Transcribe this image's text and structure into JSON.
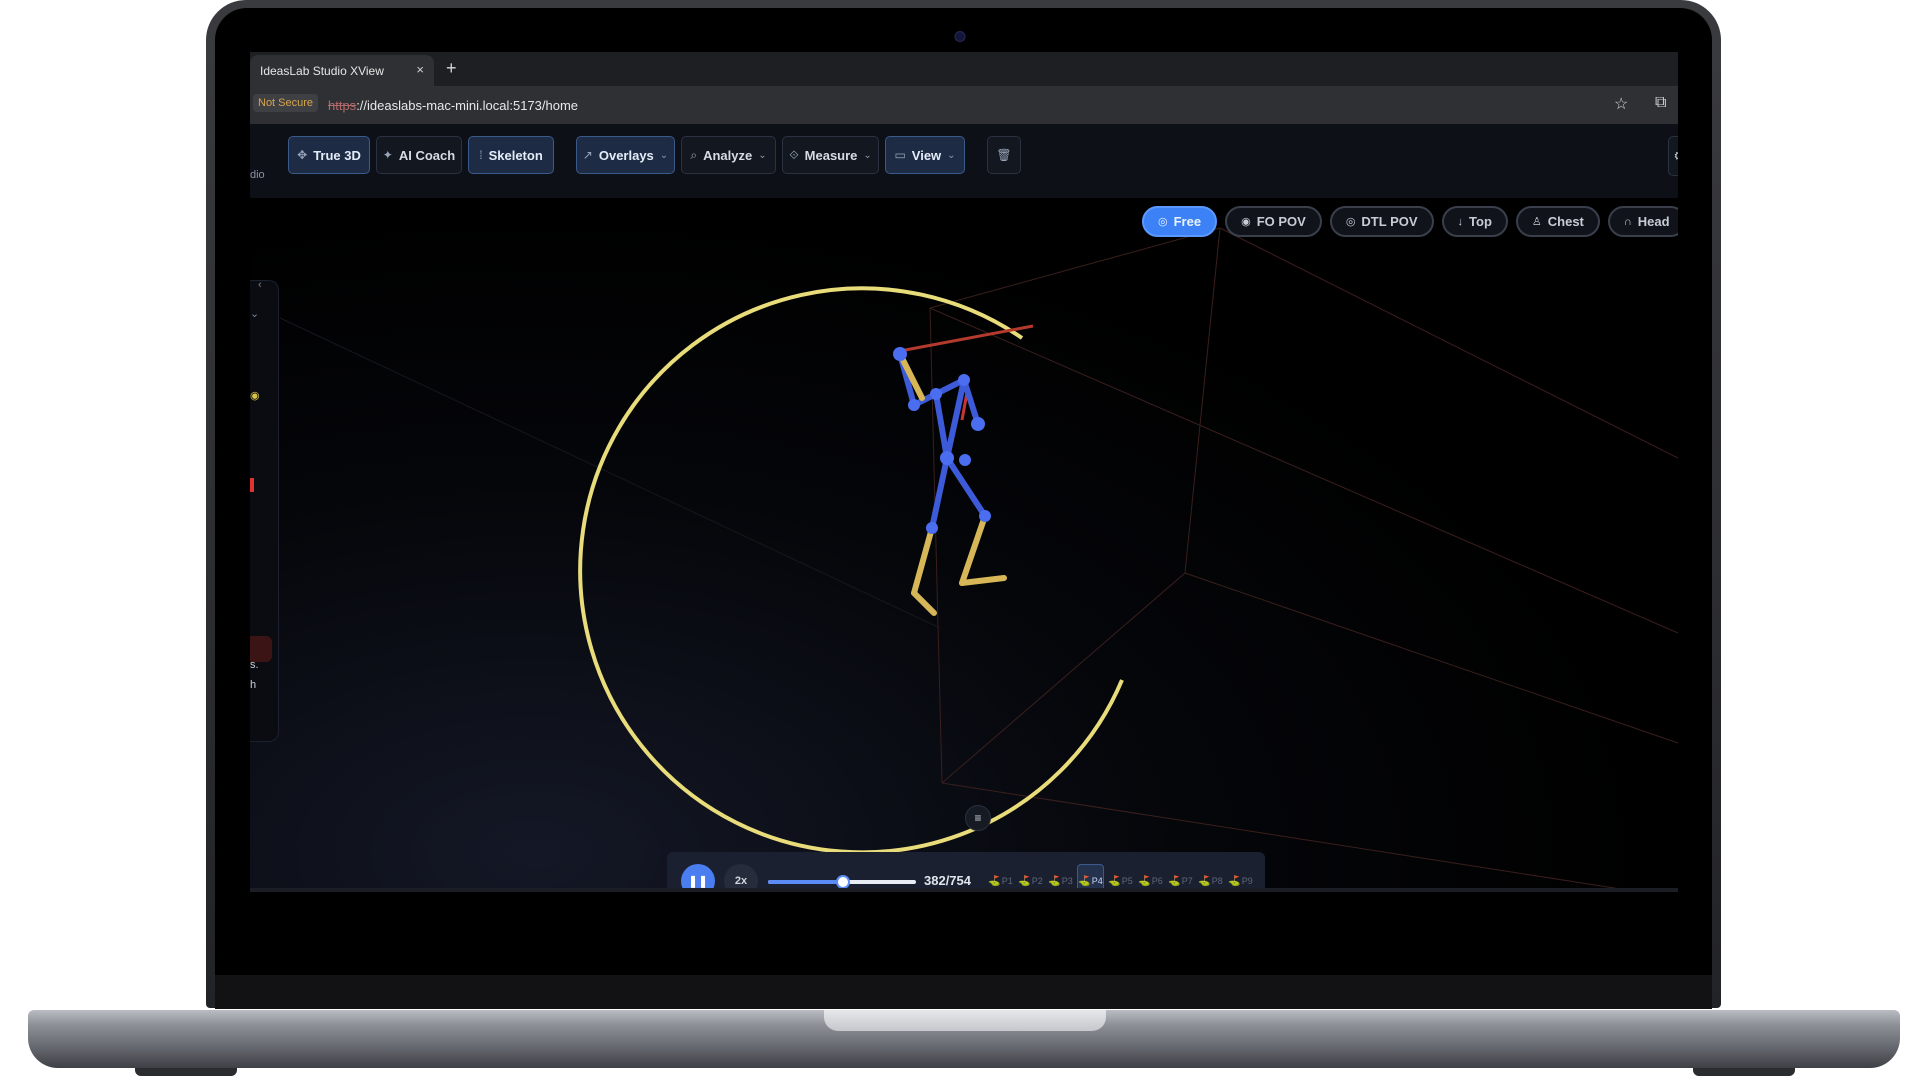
{
  "browser": {
    "tab_title": "IdeasLab Studio XView",
    "tab_close": "×",
    "new_tab": "+",
    "not_secure": "Not Secure",
    "url_scheme": "https",
    "url_rest": "://ideaslabs-mac-mini.local:5173/home"
  },
  "toolbar": {
    "brand_fragment": "dio",
    "buttons": [
      {
        "label": "True 3D",
        "icon": "cube-icon"
      },
      {
        "label": "AI Coach",
        "icon": "sparkle-icon"
      },
      {
        "label": "Skeleton",
        "icon": "skeleton-icon"
      },
      {
        "label": "Overlays",
        "icon": "overlay-icon"
      },
      {
        "label": "Analyze",
        "icon": "analyze-icon"
      },
      {
        "label": "Measure",
        "icon": "ruler-icon"
      },
      {
        "label": "View",
        "icon": "camera-icon"
      }
    ]
  },
  "camera_views": [
    {
      "label": "Free",
      "icon": "orbit-icon"
    },
    {
      "label": "FO POV",
      "icon": "eye-icon"
    },
    {
      "label": "DTL POV",
      "icon": "target-icon"
    },
    {
      "label": "Top",
      "icon": "arrow-down-icon"
    },
    {
      "label": "Chest",
      "icon": "person-icon"
    },
    {
      "label": "Head",
      "icon": "headphones-icon"
    }
  ],
  "side_panel": {
    "fragment_1": "s.",
    "fragment_2": "h"
  },
  "playback": {
    "speed": "2x",
    "frame_count": "382/754",
    "progress": 0.51,
    "phases": [
      "P1",
      "P2",
      "P3",
      "P4",
      "P5",
      "P6",
      "P7",
      "P8",
      "P9"
    ],
    "active_phase": "P4"
  },
  "colors": {
    "accent": "#3c82f6",
    "skeleton_joint": "#3d5bd8",
    "skeleton_leg": "#d6b657",
    "swing_arc": "#e9dc7a",
    "club": "#b33a2c"
  }
}
